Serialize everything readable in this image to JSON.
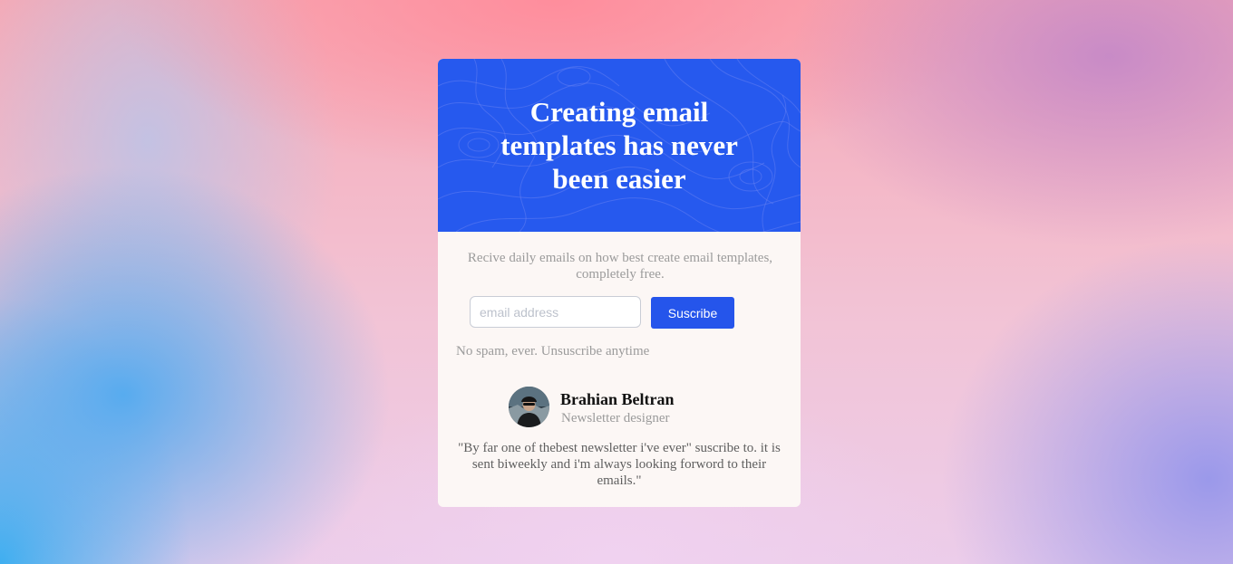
{
  "hero": {
    "title": "Creating email templates has never been easier",
    "background_color": "#2659ee"
  },
  "description": "Recive daily emails on how best create email templates, completely free.",
  "form": {
    "email_placeholder": "email address",
    "email_value": "",
    "subscribe_label": "Suscribe",
    "button_color": "#2555eb"
  },
  "disclaimer": "No spam, ever. Unsuscribe anytime",
  "testimonial": {
    "avatar_icon": "person-photo",
    "name": "Brahian Beltran",
    "role": "Newsletter designer",
    "quote": "\"By far one of thebest newsletter i've ever\" suscribe to. it is sent biweekly and i'm always looking forword to their emails.\""
  }
}
